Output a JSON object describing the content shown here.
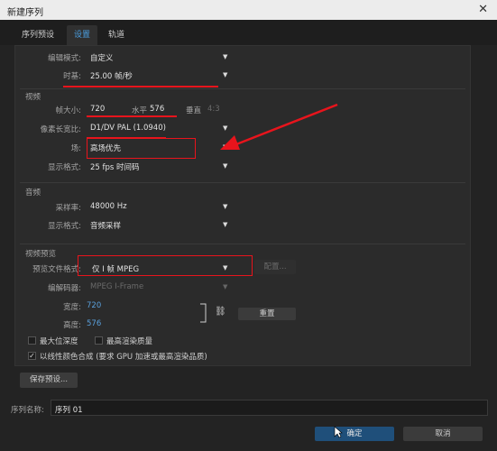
{
  "window": {
    "title": "新建序列",
    "close": "✕"
  },
  "tabs": [
    {
      "label": "序列预设"
    },
    {
      "label": "设置"
    },
    {
      "label": "轨道"
    }
  ],
  "editing": {
    "label": "编辑模式:",
    "value": "自定义"
  },
  "timebase": {
    "label": "时基:",
    "value": "25.00 帧/秒"
  },
  "video": {
    "section": "视频",
    "frame_size_label": "帧大小:",
    "width": "720",
    "horizontal_label": "水平",
    "height": "576",
    "vertical_label": "垂直",
    "aspect": "4:3",
    "pixel_aspect_label": "像素长宽比:",
    "pixel_aspect_value": "D1/DV PAL (1.0940)",
    "field_label": "场:",
    "field_value": "高场优先",
    "display_format_label": "显示格式:",
    "display_format_value": "25 fps 时间码"
  },
  "audio": {
    "section": "音频",
    "sample_rate_label": "采样率:",
    "sample_rate_value": "48000 Hz",
    "display_format_label": "显示格式:",
    "display_format_value": "音频采样"
  },
  "preview": {
    "section": "视频预览",
    "file_format_label": "预览文件格式:",
    "file_format_value": "仅 I 帧 MPEG",
    "config_button": "配置...",
    "codec_label": "编解码器:",
    "codec_value": "MPEG I-Frame",
    "width_label": "宽度:",
    "width_value": "720",
    "height_label": "高度:",
    "height_value": "576",
    "reset_button": "重置"
  },
  "options": {
    "max_depth": "最大位深度",
    "max_quality": "最高渲染质量",
    "linear_color": "以线性颜色合成 (要求 GPU 加速或最高渲染品质)"
  },
  "save_preset": "保存预设...",
  "sequence_name": {
    "label": "序列名称:",
    "value": "序列 01"
  },
  "ok_button": "确定",
  "cancel_button": "取消",
  "icons": {
    "dropdown": "▼",
    "check": "✓",
    "link": "⛓"
  },
  "colors": {
    "accent": "#4a9ee0",
    "annotation": "#e8141c",
    "ok": "#1f4f7a"
  }
}
